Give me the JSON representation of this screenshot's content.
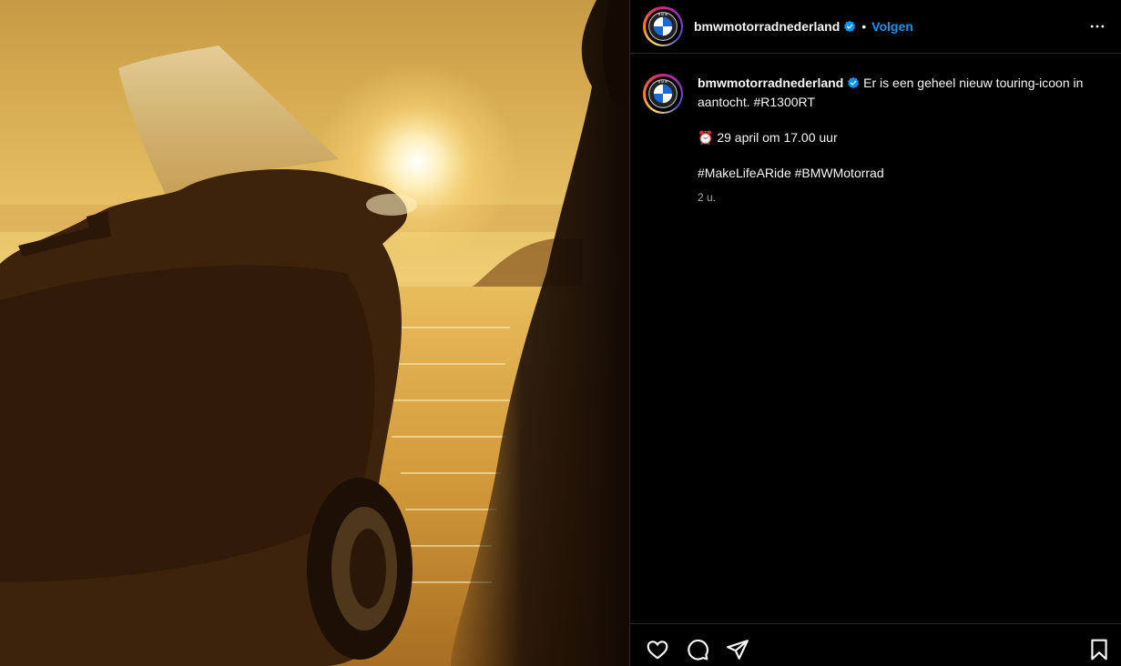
{
  "post": {
    "author": {
      "username": "bmwmotorradnederland",
      "verified": true,
      "avatar_icon": "bmw-logo-icon"
    },
    "follow_label": "Volgen",
    "separator": "•",
    "caption": {
      "username": "bmwmotorradnederland",
      "line1": "Er is een geheel nieuw touring-icoon in aantocht. #R1300RT",
      "line2_emoji": "⏰",
      "line2": "29 april om 17.00 uur",
      "line3": "#MakeLifeARide #BMWMotorrad",
      "time": "2 u."
    },
    "media": {
      "icons": [
        "motorcycle-silhouette",
        "sunset-sun",
        "sea"
      ]
    },
    "actions": [
      "heart-icon",
      "comment-icon",
      "share-icon",
      "bookmark-icon"
    ],
    "colors": {
      "accent": "#0095f6",
      "verified": "#0095f6",
      "background": "#000000"
    }
  }
}
